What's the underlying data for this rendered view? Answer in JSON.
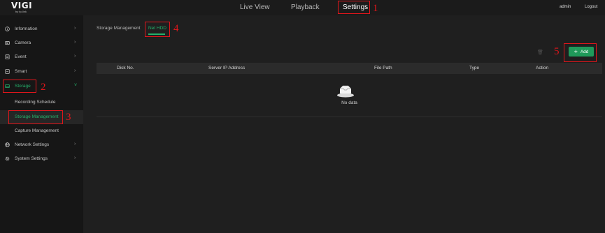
{
  "brand": {
    "logo": "VIGI",
    "sub": "by tp-link"
  },
  "topnav": {
    "live_view": "Live View",
    "playback": "Playback",
    "settings": "Settings"
  },
  "user": {
    "name": "admin",
    "logout": "Logout"
  },
  "sidebar": {
    "items": [
      {
        "label": "Information",
        "icon": "info-icon"
      },
      {
        "label": "Camera",
        "icon": "camera-icon"
      },
      {
        "label": "Event",
        "icon": "event-icon"
      },
      {
        "label": "Smart",
        "icon": "smart-icon"
      },
      {
        "label": "Storage",
        "icon": "storage-icon"
      },
      {
        "label": "Recording Schedule"
      },
      {
        "label": "Storage Management"
      },
      {
        "label": "Capture Management"
      },
      {
        "label": "Network Settings",
        "icon": "globe-icon"
      },
      {
        "label": "System Settings",
        "icon": "gear-icon"
      }
    ]
  },
  "tabs": {
    "storage_management": "Storage Management",
    "net_hdd": "Net HDD"
  },
  "toolbar": {
    "add_label": "Add"
  },
  "table": {
    "columns": [
      "Disk No.",
      "Server IP Address",
      "File Path",
      "Type",
      "Action"
    ],
    "empty_text": "No data"
  },
  "annotations": [
    "1",
    "2",
    "3",
    "4",
    "5"
  ],
  "colors": {
    "accent": "#25b16b",
    "annotation": "#e0161b",
    "background": "#1f1f1f"
  }
}
